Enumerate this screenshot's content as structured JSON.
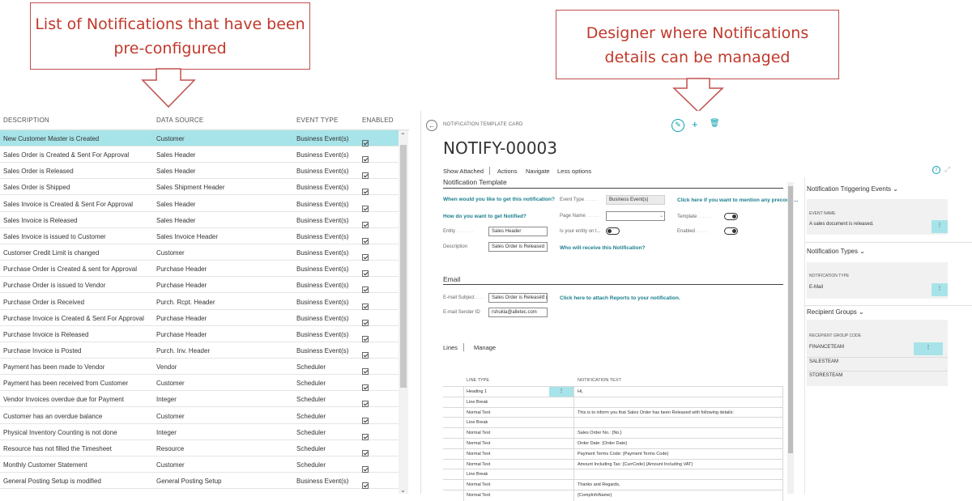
{
  "callouts": {
    "left_line1": "List of Notifications that have been",
    "left_line2": "pre-configured",
    "right_line1": "Designer where Notifications",
    "right_line2": "details can be managed"
  },
  "list": {
    "headers": [
      "DESCRIPTION",
      "DATA SOURCE",
      "EVENT TYPE",
      "ENABLED"
    ],
    "rows": [
      {
        "description": "New Customer Master is Created",
        "source": "Customer",
        "event": "Business Event(s)",
        "enabled": true
      },
      {
        "description": "Sales Order is Created & Sent For Approval",
        "source": "Sales Header",
        "event": "Business Event(s)",
        "enabled": true
      },
      {
        "description": "Sales Order is Released",
        "source": "Sales Header",
        "event": "Business Event(s)",
        "enabled": true
      },
      {
        "description": "Sales Order is Shipped",
        "source": "Sales Shipment Header",
        "event": "Business Event(s)",
        "enabled": true
      },
      {
        "description": "Sales Invoice is Created & Sent For Approval",
        "source": "Sales Header",
        "event": "Business Event(s)",
        "enabled": true
      },
      {
        "description": "Sales Invoice is Released",
        "source": "Sales Header",
        "event": "Business Event(s)",
        "enabled": true
      },
      {
        "description": "Sales Invoice is issued to Customer",
        "source": "Sales Invoice Header",
        "event": "Business Event(s)",
        "enabled": true
      },
      {
        "description": "Customer Credit Limit is changed",
        "source": "Customer",
        "event": "Business Event(s)",
        "enabled": true
      },
      {
        "description": "Purchase Order is Created & sent for Approval",
        "source": "Purchase Header",
        "event": "Business Event(s)",
        "enabled": true
      },
      {
        "description": "Purchase Order is issued to Vendor",
        "source": "Purchase Header",
        "event": "Business Event(s)",
        "enabled": true
      },
      {
        "description": "Purchase Order is Received",
        "source": "Purch. Rcpt. Header",
        "event": "Business Event(s)",
        "enabled": true
      },
      {
        "description": "Purchase Invoice is Created & Sent For Approval",
        "source": "Purchase Header",
        "event": "Business Event(s)",
        "enabled": true
      },
      {
        "description": "Purchase Invoice is Released",
        "source": "Purchase Header",
        "event": "Business Event(s)",
        "enabled": true
      },
      {
        "description": "Purchase Invoice is Posted",
        "source": "Purch. Inv. Header",
        "event": "Business Event(s)",
        "enabled": true
      },
      {
        "description": "Payment has been made to Vendor",
        "source": "Vendor",
        "event": "Scheduler",
        "enabled": true
      },
      {
        "description": "Payment has been received from Customer",
        "source": "Customer",
        "event": "Scheduler",
        "enabled": true
      },
      {
        "description": "Vendor Invoices overdue due for Payment",
        "source": "Integer",
        "event": "Scheduler",
        "enabled": true
      },
      {
        "description": "Customer has an overdue balance",
        "source": "Customer",
        "event": "Scheduler",
        "enabled": true
      },
      {
        "description": "Physical Inventory Counting is not done",
        "source": "Integer",
        "event": "Scheduler",
        "enabled": true
      },
      {
        "description": "Resource has not filled the Timesheet",
        "source": "Resource",
        "event": "Scheduler",
        "enabled": true
      },
      {
        "description": "Monthly Customer Statement",
        "source": "Customer",
        "event": "Scheduler",
        "enabled": true
      },
      {
        "description": "General Posting Setup is modified",
        "source": "General Posting Setup",
        "event": "Business Event(s)",
        "enabled": true
      }
    ]
  },
  "card": {
    "caption": "NOTIFICATION TEMPLATE CARD",
    "title": "NOTIFY-00003",
    "actions": [
      "Show Attached",
      "Actions",
      "Navigate",
      "Less options"
    ],
    "template_section": "Notification Template",
    "q_get": "When would you like to get this notification?",
    "q_how": "How do you want to get Notified?",
    "q_who": "Who will receive this Notification?",
    "q_precond": "Click here if you want to mention any precondi...",
    "entity_label": "Entity",
    "entity_value": "Sales Header",
    "description_label": "Description",
    "description_value": "Sales Order is Released",
    "event_type_label": "Event Type",
    "event_type_value": "Business Event(s)",
    "page_name_label": "Page Name",
    "page_name_value": "",
    "entity_on_label": "Is your entity on t...",
    "template_label": "Template",
    "enabled_label": "Enabled",
    "email_section": "Email",
    "email_subject_label": "E-mail Subject",
    "email_subject_value": "Sales Order is Released (",
    "email_sender_label": "E-mail Sender ID",
    "email_sender_value": "rshukla@alletec.com",
    "attach_link": "Click here to attach Reports to your notification.",
    "lines_tab": "Lines",
    "manage_tab": "Manage",
    "line_headers": [
      "LINE TYPE",
      "NOTIFICATION TEXT"
    ],
    "lines": [
      {
        "type": "Heading 1",
        "text": "Hi,"
      },
      {
        "type": "Line Break",
        "text": ""
      },
      {
        "type": "Normal Text",
        "text": "This is to inform you that Sales Order has been Released with following details:"
      },
      {
        "type": "Line Break",
        "text": ""
      },
      {
        "type": "Normal Text",
        "text": "Sales Order No.: {No.}"
      },
      {
        "type": "Normal Text",
        "text": "Order Date: {Order Date}"
      },
      {
        "type": "Normal Text",
        "text": "Payment Terms Code: {Payment Terms Code}"
      },
      {
        "type": "Normal Text",
        "text": "Amount Including Tax: {CurrCode} {Amount Including VAT}"
      },
      {
        "type": "Line Break",
        "text": ""
      },
      {
        "type": "Normal Text",
        "text": "Thanks and Regards,"
      },
      {
        "type": "Normal Text",
        "text": "{CompInfoName}"
      }
    ]
  },
  "factbox": {
    "triggering_title": "Notification Triggering Events",
    "event_caption": "EVENT NAME",
    "event_value": "A sales document is released.",
    "types_title": "Notification Types",
    "type_caption": "NOTIFICATION TYPE",
    "type_value": "E-Mail",
    "groups_title": "Recipient Groups",
    "group_caption": "RECEPIENT GROUP CODE",
    "groups": [
      "FINANCETEAM",
      "SALESTEAM",
      "STORESTEAM"
    ]
  },
  "icons": {
    "edit": "pencil-icon",
    "new": "plus-icon",
    "delete": "trash-icon",
    "back": "back-arrow-icon",
    "info": "info-icon",
    "expand": "expand-icon"
  },
  "colors": {
    "accent": "#0aa0b0",
    "selection": "#a7e4e9",
    "callout_text": "#c0392b",
    "callout_border": "#c0504d"
  }
}
